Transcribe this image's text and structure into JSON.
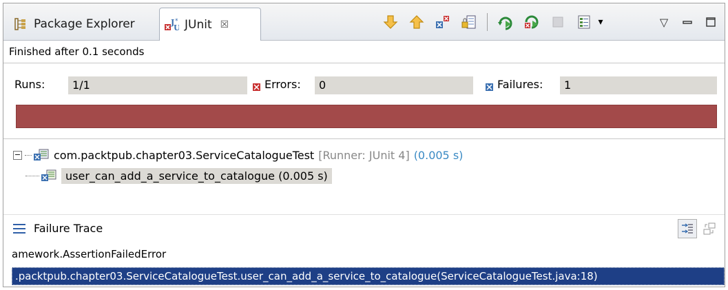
{
  "tabs": {
    "package_explorer": "Package Explorer",
    "junit": "JUnit",
    "junit_close": "☒"
  },
  "toolbar": {
    "icons": [
      "next-failure-icon",
      "previous-failure-icon",
      "show-failures-only-icon",
      "scroll-lock-icon",
      "rerun-test-icon",
      "rerun-failed-first-icon",
      "stop-icon",
      "test-run-history-icon",
      "dropdown-arrow-icon",
      "view-menu-icon",
      "minimize-icon",
      "maximize-icon"
    ],
    "dropdown_glyph": "▾",
    "view_menu_glyph": "▽"
  },
  "status": {
    "finished_text": "Finished after 0.1 seconds"
  },
  "counters": {
    "runs_label": "Runs:",
    "runs_value": "1/1",
    "errors_label": "Errors:",
    "errors_value": "0",
    "failures_label": "Failures:",
    "failures_value": "1"
  },
  "progress": {
    "color": "#a34a4a",
    "fraction": 1.0
  },
  "tree": {
    "suite_name": "com.packtpub.chapter03.ServiceCatalogueTest",
    "suite_runner": "[Runner: JUnit 4]",
    "suite_time": "(0.005 s)",
    "test_name": "user_can_add_a_service_to_catalogue (0.005 s)"
  },
  "trace": {
    "title": "Failure Trace",
    "line1": "amework.AssertionFailedError",
    "line2": ".packtpub.chapter03.ServiceCatalogueTest.user_can_add_a_service_to_catalogue(ServiceCatalogueTest.java:18)"
  },
  "colors": {
    "progress_fail": "#a34a4a",
    "selection": "#1e3f86",
    "counter_bg": "#dcdad5",
    "time_blue": "#3a8ac4"
  }
}
